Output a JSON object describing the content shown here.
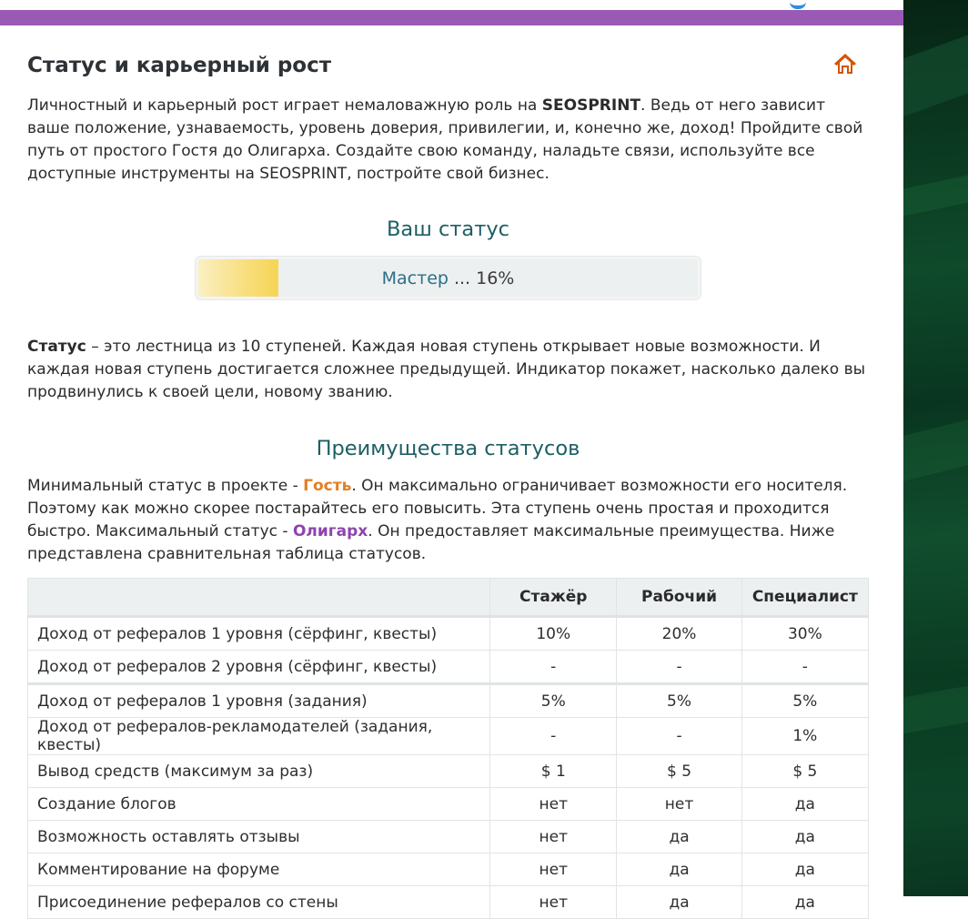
{
  "page": {
    "title": "Статус и карьерный рост",
    "intro": {
      "part1": "Личностный и карьерный рост играет немаловажную роль на ",
      "brand": "SEOSPRINT",
      "part2": ". Ведь от него зависит ваше положение, узнаваемость, уровень доверия, привилегии, и, конечно же, доход! Пройдите свой путь от простого Гостя до Олигарха. Создайте свою команду, наладьте связи, используйте все доступные инструменты на SEOSPRINT, постройте свой бизнес."
    }
  },
  "status": {
    "heading": "Ваш статус",
    "level_name": "Мастер",
    "progress_text": "... 16%",
    "progress_fraction": 0.16,
    "description_bold": "Статус",
    "description": " – это лестница из 10 ступеней. Каждая новая ступень открывает новые возможности. И каждая новая ступень достигается сложнее предыдущей. Индикатор покажет, насколько далеко вы продвинулись к своей цели, новому званию."
  },
  "advantages": {
    "heading": "Преимущества статусов",
    "t1": "Минимальный статус в проекте - ",
    "min_status": "Гость",
    "t2": ". Он максимально ограничивает возможности его носителя. Поэтому как можно скорее постарайтесь его повысить. Эта ступень очень простая и проходится быстро. Максимальный статус - ",
    "max_status": "Олигарх",
    "t3": ". Он предоставляет максимальные преимущества. Ниже представлена сравнительная таблица статусов."
  },
  "table": {
    "headers": [
      "",
      "Стажёр",
      "Рабочий",
      "Специалист"
    ],
    "rows": [
      [
        "Доход от рефералов 1 уровня (сёрфинг, квесты)",
        "10%",
        "20%",
        "30%"
      ],
      [
        "Доход от рефералов 2 уровня (сёрфинг, квесты)",
        "-",
        "-",
        "-"
      ],
      [
        "Доход от рефералов 1 уровня (задания)",
        "5%",
        "5%",
        "5%"
      ],
      [
        "Доход от рефералов-рекламодателей (задания, квесты)",
        "-",
        "-",
        "1%"
      ],
      [
        "Вывод средств (максимум за раз)",
        "$ 1",
        "$ 5",
        "$ 5"
      ],
      [
        "Создание блогов",
        "нет",
        "нет",
        "да"
      ],
      [
        "Возможность оставлять отзывы",
        "нет",
        "да",
        "да"
      ],
      [
        "Комментирование на форуме",
        "нет",
        "да",
        "да"
      ],
      [
        "Присоединение рефералов со стены",
        "нет",
        "да",
        "да"
      ]
    ]
  },
  "colors": {
    "accent_bar": "#9b59b6",
    "heading_teal": "#1c5f63",
    "guest_orange": "#e67e22",
    "oligarch_purple": "#8e44ad",
    "home_icon": "#d35400",
    "progress_fill": "#f6d554"
  },
  "icons": {
    "home": "home-icon"
  }
}
